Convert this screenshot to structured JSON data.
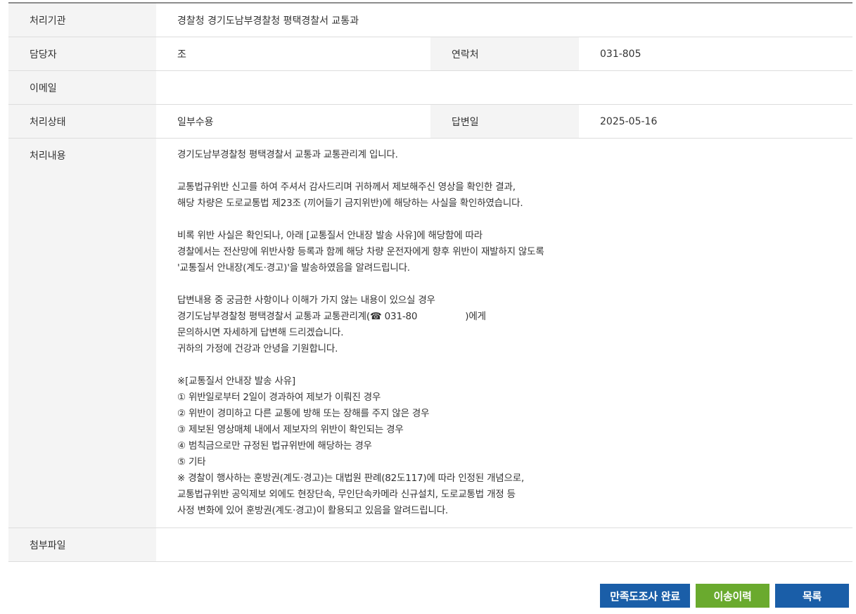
{
  "rows": {
    "agency": {
      "label": "처리기관",
      "value": "경찰청 경기도남부경찰청 평택경찰서 교통과"
    },
    "manager": {
      "label": "담당자",
      "value": "조",
      "contact_label": "연락처",
      "contact_value": "031-805"
    },
    "email": {
      "label": "이메일",
      "value": ""
    },
    "status": {
      "label": "처리상태",
      "value": "일부수용",
      "date_label": "답변일",
      "date_value": "2025-05-16"
    },
    "content": {
      "label": "처리내용",
      "lines": [
        "경기도남부경찰청 평택경찰서 교통과 교통관리계 입니다.",
        "",
        "교통법규위반 신고를 하여 주셔서 감사드리며 귀하께서 제보해주신 영상을 확인한 결과,",
        "해당 차량은 도로교통법 제23조 (끼어들기 금지위반)에 해당하는 사실을 확인하였습니다.",
        "",
        "비록 위반 사실은 확인되나, 아래 [교통질서 안내장 발송 사유]에 해당함에 따라",
        "경찰에서는 전산망에 위반사항 등록과 함께 해당 차량 운전자에게 향후 위반이 재발하지 않도록",
        "'교통질서 안내장(계도·경고)'을 발송하였음을 알려드립니다.",
        "",
        "답변내용 중 궁금한 사항이나 이해가 가지 않는 내용이 있으실 경우",
        "경기도남부경찰청 평택경찰서 교통과 교통관리계(☎ 031-80",
        "문의하시면 자세하게 답변해 드리겠습니다.",
        "귀하의 가정에 건강과 안녕을 기원합니다.",
        "",
        "※[교통질서 안내장 발송 사유]",
        "① 위반일로부터 2일이 경과하여 제보가 이뤄진 경우",
        "② 위반이 경미하고 다른 교통에 방해 또는 장해를 주지 않은 경우",
        "③ 제보된 영상매체 내에서 제보자의 위반이 확인되는 경우",
        "④ 범칙금으로만 규정된 법규위반에 해당하는 경우",
        "⑤ 기타",
        "※ 경찰이 행사하는 훈방권(계도·경고)는 대법원 판례(82도117)에 따라 인정된 개념으로,",
        "교통법규위반 공익제보 외에도 현장단속, 무인단속카메라 신규설치, 도로교통법 개정 등",
        "사정 변화에 있어 훈방권(계도·경고)이 활용되고 있음을 알려드립니다."
      ],
      "phone_suffix": ")에게"
    },
    "attachment": {
      "label": "첨부파일",
      "value": ""
    }
  },
  "buttons": {
    "survey": "만족도조사 완료",
    "history": "이송이력",
    "list": "목록"
  },
  "colors": {
    "header_bg": "#f4f4f4",
    "border": "#dddddd",
    "top_border": "#8c8c8c",
    "btn_blue": "#1a5ea8",
    "btn_green": "#6aaa2e"
  }
}
